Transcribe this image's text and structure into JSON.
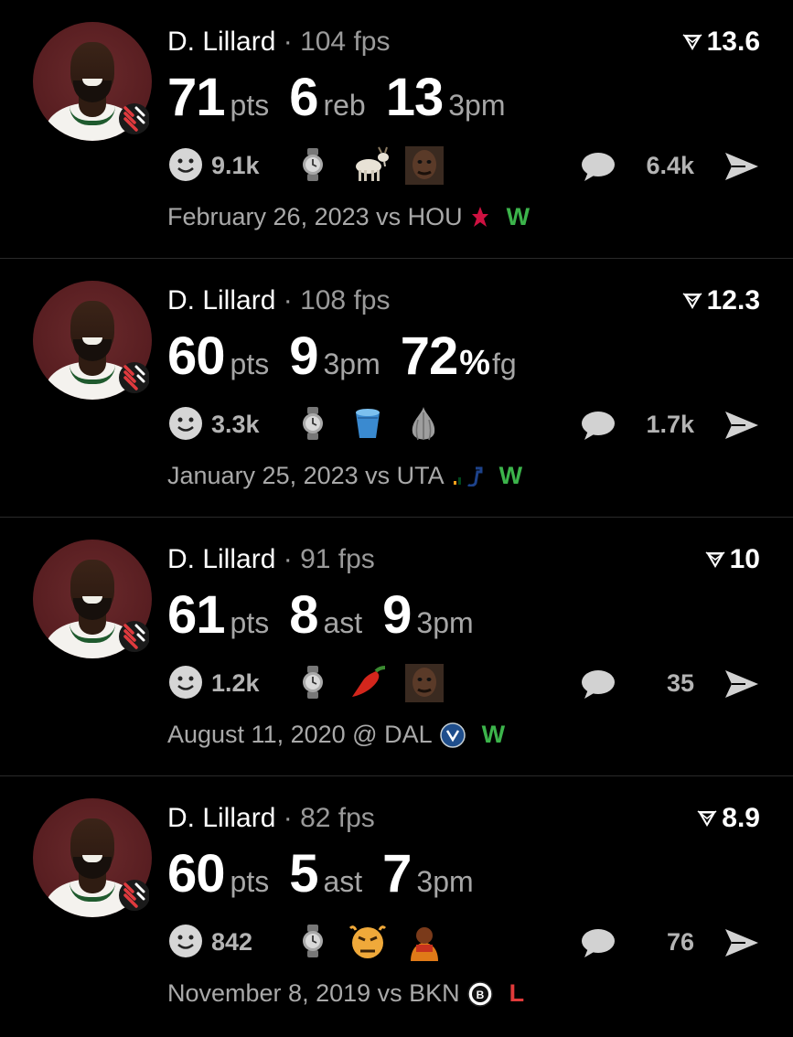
{
  "cards": [
    {
      "player": "D. Lillard",
      "separator": "·",
      "fps": "104 fps",
      "rank": "13.6",
      "stats": [
        {
          "value": "71",
          "label": "pts"
        },
        {
          "value": "6",
          "label": "reb"
        },
        {
          "value": "13",
          "label": "3pm"
        }
      ],
      "reactions_count": "9.1k",
      "emojis": [
        "goat-emoji",
        "face-emoji"
      ],
      "comments_count": "6.4k",
      "date": "February 26, 2023 vs HOU",
      "team_logo": "rockets-logo",
      "result": "W"
    },
    {
      "player": "D. Lillard",
      "separator": "·",
      "fps": "108 fps",
      "rank": "12.3",
      "stats": [
        {
          "value": "60",
          "label": "pts"
        },
        {
          "value": "9",
          "label": "3pm"
        },
        {
          "value": "72",
          "pct": "%",
          "label": "fg"
        }
      ],
      "reactions_count": "3.3k",
      "emojis": [
        "bucket-emoji",
        "garlic-emoji"
      ],
      "comments_count": "1.7k",
      "date": "January 25, 2023 vs UTA",
      "team_logo": "jazz-logo",
      "result": "W"
    },
    {
      "player": "D. Lillard",
      "separator": "·",
      "fps": "91 fps",
      "rank": "10",
      "stats": [
        {
          "value": "61",
          "label": "pts"
        },
        {
          "value": "8",
          "label": "ast"
        },
        {
          "value": "9",
          "label": "3pm"
        }
      ],
      "reactions_count": "1.2k",
      "emojis": [
        "hot-pepper-emoji",
        "face-emoji"
      ],
      "comments_count": "35",
      "date": "August 11, 2020 @ DAL",
      "team_logo": "mavericks-logo",
      "result": "W"
    },
    {
      "player": "D. Lillard",
      "separator": "·",
      "fps": "82 fps",
      "rank": "8.9",
      "stats": [
        {
          "value": "60",
          "label": "pts"
        },
        {
          "value": "5",
          "label": "ast"
        },
        {
          "value": "7",
          "label": "3pm"
        }
      ],
      "reactions_count": "842",
      "emojis": [
        "angry-face-emoji",
        "person-emoji"
      ],
      "comments_count": "76",
      "date": "November 8, 2019 vs BKN",
      "team_logo": "nets-logo",
      "result": "L"
    }
  ],
  "colors": {
    "background": "#000000",
    "win": "#3cb44b",
    "loss": "#e03a3a",
    "muted": "#9a9a9a"
  }
}
